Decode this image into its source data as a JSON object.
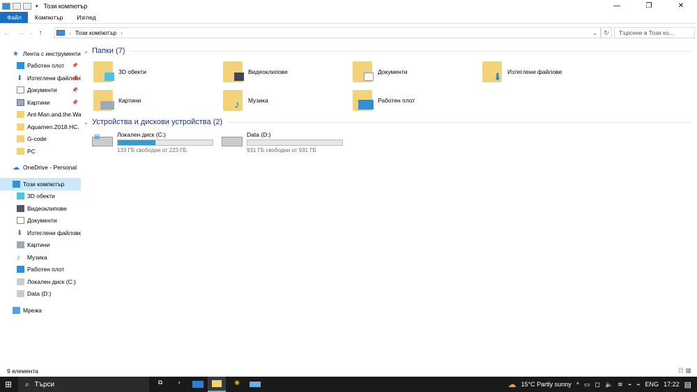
{
  "window": {
    "title": "Този компютър",
    "controls": [
      "—",
      "❐",
      "✕"
    ]
  },
  "ribbon": {
    "tabs": [
      "Файл",
      "Компютър",
      "Изглед"
    ]
  },
  "address": {
    "path": "Този компютър",
    "search_placeholder": "Търсене в Този ко..."
  },
  "nav": {
    "quick_access": "Лента с инструменти",
    "quick_items": [
      {
        "label": "Работен плот",
        "pinned": true
      },
      {
        "label": "Изтеглени файлове",
        "pinned": true
      },
      {
        "label": "Документи",
        "pinned": true
      },
      {
        "label": "Картини",
        "pinned": true
      },
      {
        "label": "Ant-Man.and.the.Wasp"
      },
      {
        "label": "Aquamen.2018.HC."
      },
      {
        "label": "G-code"
      },
      {
        "label": "PC"
      }
    ],
    "onedrive": "OneDrive - Personal",
    "this_pc": "Този компютър",
    "pc_items": [
      "3D обекти",
      "Видеоклипове",
      "Документи",
      "Изтеглени файлове",
      "Картини",
      "Музика",
      "Работен плот",
      "Локален диск (C:)",
      "Data (D:)"
    ],
    "network": "Мрежа"
  },
  "content": {
    "folders_header": "Папки (7)",
    "folders": [
      "3D обекти",
      "Видеоклипове",
      "Документи",
      "Изтеглени файлове",
      "Картини",
      "Музика",
      "Работен плот"
    ],
    "devices_header": "Устройства и дискови устройства (2)",
    "drives": [
      {
        "name": "Локален диск (C:)",
        "free": "133 ГБ свободни от 223 ГБ",
        "used_percent": 40
      },
      {
        "name": "Data (D:)",
        "free": "931 ГБ свободни от 931 ГБ",
        "used_percent": 0
      }
    ]
  },
  "status": {
    "items": "9 елемента"
  },
  "taskbar": {
    "search": "Търси",
    "weather": "15°C  Partly sunny",
    "lang": "ENG",
    "time": "17:22"
  },
  "colors": {
    "accent": "#1a6fc0",
    "bar": "#26a0da",
    "selection": "#cce8ff",
    "folder": "#f3d37a"
  }
}
